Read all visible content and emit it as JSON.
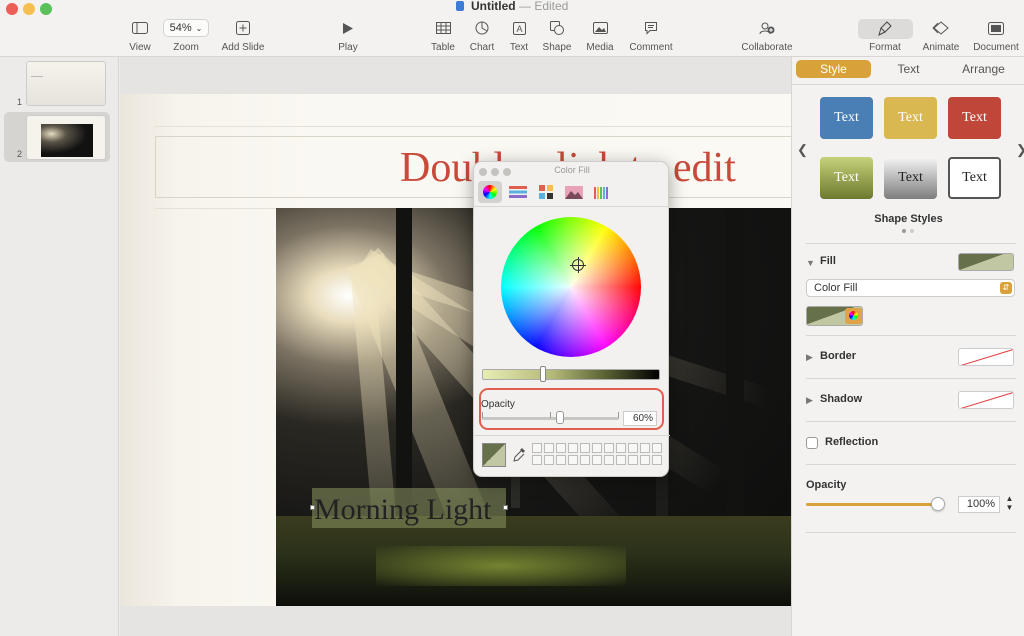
{
  "window": {
    "title": "Untitled",
    "title_separator": "—",
    "status": "Edited"
  },
  "toolbar": {
    "items": [
      {
        "key": "view",
        "label": "View",
        "icon": "sidebar-icon"
      },
      {
        "key": "zoom",
        "label": "Zoom",
        "value": "54%",
        "icon": "chevron-down-icon"
      },
      {
        "key": "add_slide",
        "label": "Add Slide",
        "icon": "plus-square-icon"
      },
      {
        "key": "play",
        "label": "Play",
        "icon": "play-icon"
      },
      {
        "key": "table",
        "label": "Table",
        "icon": "table-icon"
      },
      {
        "key": "chart",
        "label": "Chart",
        "icon": "pie-chart-icon"
      },
      {
        "key": "text",
        "label": "Text",
        "icon": "text-box-icon"
      },
      {
        "key": "shape",
        "label": "Shape",
        "icon": "shape-icon"
      },
      {
        "key": "media",
        "label": "Media",
        "icon": "photo-icon"
      },
      {
        "key": "comment",
        "label": "Comment",
        "icon": "comment-icon"
      },
      {
        "key": "collaborate",
        "label": "Collaborate",
        "icon": "collaborate-icon"
      },
      {
        "key": "format",
        "label": "Format",
        "icon": "paintbrush-icon",
        "active": true
      },
      {
        "key": "animate",
        "label": "Animate",
        "icon": "diamond-icon"
      },
      {
        "key": "document",
        "label": "Document",
        "icon": "document-icon"
      }
    ]
  },
  "navigator": {
    "slides": [
      {
        "number": "1"
      },
      {
        "number": "2",
        "selected": true
      }
    ]
  },
  "slide": {
    "title": "Double-click to edit",
    "text_box": "Morning Light"
  },
  "color_fill": {
    "title": "Color Fill",
    "tabs": [
      "color-wheel-icon",
      "color-sliders-icon",
      "color-palettes-icon",
      "image-palettes-icon",
      "pencils-icon"
    ],
    "active_tab": "color-wheel-icon",
    "opacity_label": "Opacity",
    "opacity_value": "60%",
    "opacity_level": 0.6,
    "current_color": "#66704a",
    "swatch_slots": 22
  },
  "inspector": {
    "tabs": [
      "Style",
      "Text",
      "Arrange"
    ],
    "active_tab": "Style",
    "shape_styles": [
      {
        "label": "Text",
        "bg": "#4a7fb5",
        "fg": "#ffffff"
      },
      {
        "label": "Text",
        "bg": "#d9b852",
        "fg": "#ffffff"
      },
      {
        "label": "Text",
        "bg": "#c0463a",
        "fg": "#ffffff"
      },
      {
        "label": "Text",
        "bg": "#9aab46",
        "fg": "#ffffff"
      },
      {
        "label": "Text",
        "bg": "#9c9c9c",
        "fg": "#222222"
      },
      {
        "label": "Text",
        "bg": "#ffffff",
        "fg": "#222222"
      }
    ],
    "shape_styles_label": "Shape Styles",
    "fill_label": "Fill",
    "fill_type": "Color Fill",
    "border_label": "Border",
    "shadow_label": "Shadow",
    "reflection_label": "Reflection",
    "opacity_label": "Opacity",
    "opacity_value": "100%",
    "accent": "#d9a13a"
  }
}
